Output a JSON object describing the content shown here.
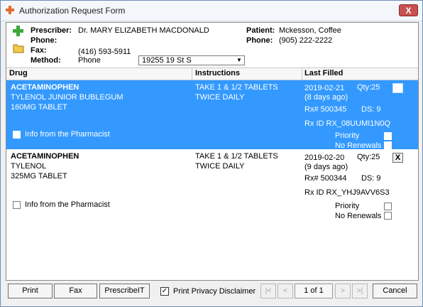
{
  "window": {
    "title": "Authorization Request Form",
    "close_label": "X"
  },
  "header": {
    "prescriber_label": "Prescriber:",
    "prescriber_value": "Dr. MARY ELIZABETH MACDONALD",
    "phone_label": "Phone:",
    "phone_value": "",
    "fax_label": "Fax:",
    "fax_value": "(416) 593-5911",
    "method_label": "Method:",
    "method_value": "Phone",
    "address_value": "19255  19 St S",
    "patient_label": "Patient:",
    "patient_value": "Mckesson, Coffee",
    "patient_phone_label": "Phone:",
    "patient_phone_value": "(905) 222-2222"
  },
  "columns": {
    "drug": "Drug",
    "instructions": "Instructions",
    "last_filled": "Last Filled"
  },
  "rows": [
    {
      "drug_generic": "ACETAMINOPHEN",
      "drug_brand": "TYLENOL JUNIOR BUBLEGUM",
      "drug_form": "160MG TABLET",
      "instr_1": "TAKE 1 & 1/2 TABLETS",
      "instr_2": "TWICE DAILY",
      "date": "2019-02-21",
      "ago": "(8 days ago)",
      "qty": "Qty:25",
      "rx": "Rx# 500345",
      "ds": "DS: 9",
      "rxid": "Rx ID RX_08UUMI1N0Q",
      "info_label": "Info from the Pharmacist",
      "priority_label": "Priority",
      "norenewals_label": "No Renewals",
      "remove_label": ""
    },
    {
      "drug_generic": "ACETAMINOPHEN",
      "drug_brand": "TYLENOL",
      "drug_form": "325MG TABLET",
      "instr_1": "TAKE 1 & 1/2 TABLETS",
      "instr_2": "TWICE DAILY",
      "date": "2019-02-20",
      "ago": "(9 days ago)",
      "qty": "Qty:25",
      "rx": "Rx# 500344",
      "ds": "DS: 9",
      "rxid": "Rx ID RX_YHJ9AVV6S3",
      "info_label": "Info from the Pharmacist",
      "priority_label": "Priority",
      "norenewals_label": "No Renewals",
      "remove_label": "X"
    }
  ],
  "footer": {
    "print_label": "Print",
    "fax_label": "Fax",
    "prescribeit_label": "PrescribeIT",
    "privacy_label": "Print Privacy Disclaimer",
    "privacy_checked": "✓",
    "page_label": "1 of 1",
    "first_label": "|<",
    "prev_label": "<",
    "next_label": ">",
    "last_label": ">|",
    "cancel_label": "Cancel"
  },
  "colors": {
    "selected_row": "#3399ff",
    "accent_plus": "#3aa83a",
    "close_button": "#c75050"
  },
  "icons": [
    "app-plus-icon",
    "prescriber-plus-icon",
    "folder-icon",
    "chevron-down-icon",
    "close-icon",
    "checkmark-icon"
  ]
}
